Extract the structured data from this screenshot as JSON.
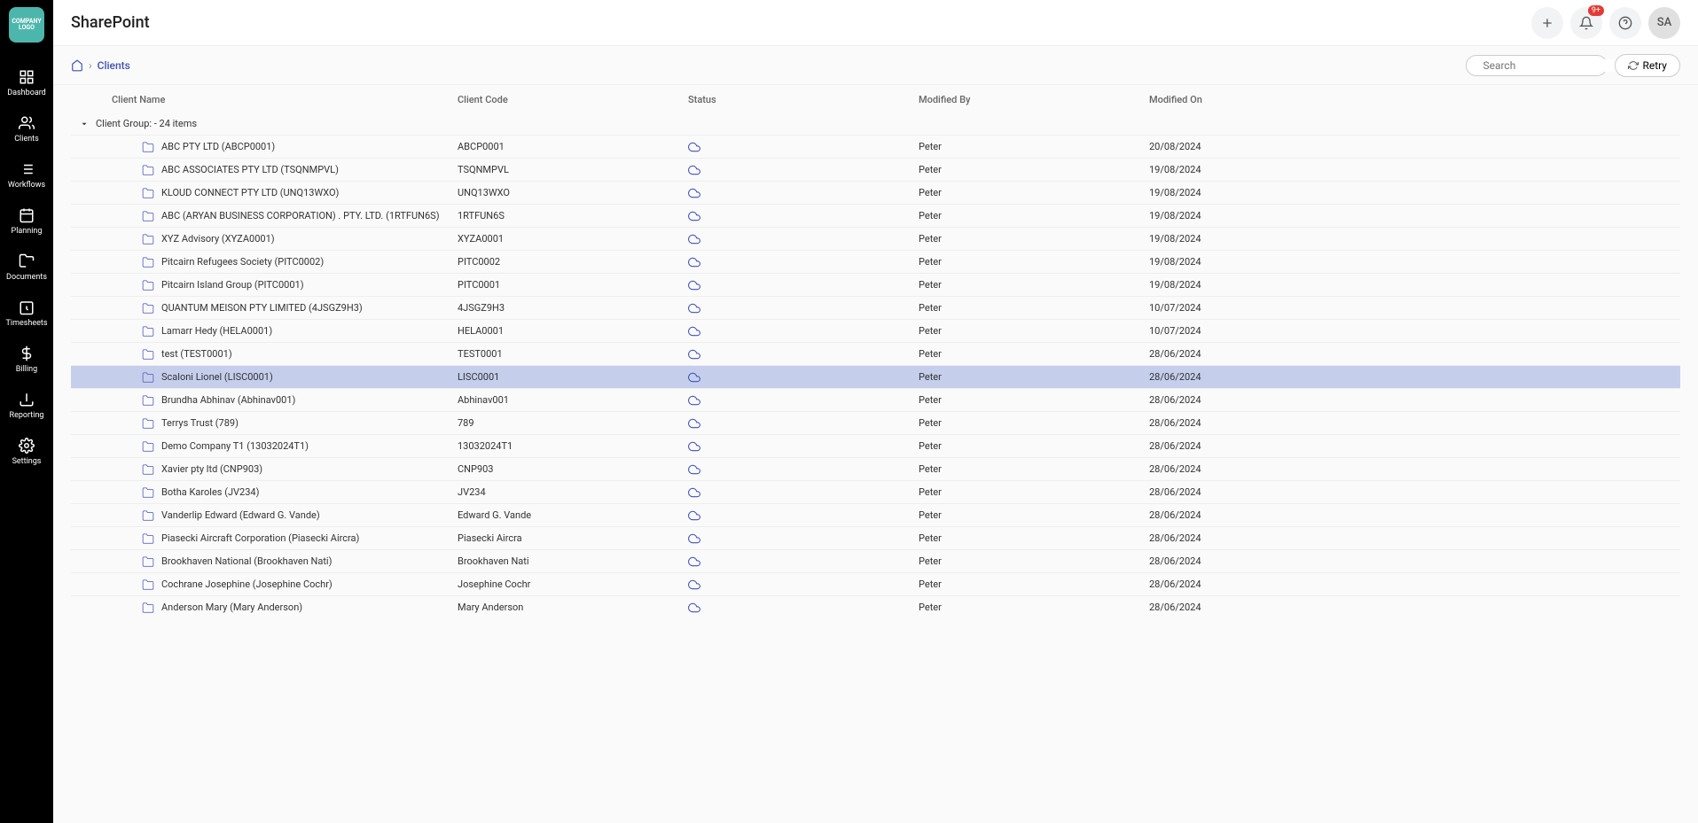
{
  "header": {
    "title": "SharePoint",
    "badge": "9+",
    "avatar": "SA"
  },
  "sidebar": {
    "items": [
      {
        "id": "dashboard",
        "label": "Dashboard"
      },
      {
        "id": "clients",
        "label": "Clients"
      },
      {
        "id": "workflows",
        "label": "Workflows"
      },
      {
        "id": "planning",
        "label": "Planning"
      },
      {
        "id": "documents",
        "label": "Documents"
      },
      {
        "id": "timesheets",
        "label": "Timesheets"
      },
      {
        "id": "billing",
        "label": "Billing"
      },
      {
        "id": "reporting",
        "label": "Reporting"
      },
      {
        "id": "settings",
        "label": "Settings"
      }
    ]
  },
  "breadcrumb": {
    "current": "Clients"
  },
  "search": {
    "placeholder": "Search"
  },
  "retry": {
    "label": "Retry"
  },
  "columns": {
    "name": "Client Name",
    "code": "Client Code",
    "status": "Status",
    "modifiedBy": "Modified By",
    "modifiedOn": "Modified On"
  },
  "group": {
    "label": "Client Group: - 24 items"
  },
  "rows": [
    {
      "name": "ABC PTY LTD (ABCP0001)",
      "code": "ABCP0001",
      "modifiedBy": "Peter",
      "modifiedOn": "20/08/2024"
    },
    {
      "name": "ABC ASSOCIATES PTY LTD (TSQNMPVL)",
      "code": "TSQNMPVL",
      "modifiedBy": "Peter",
      "modifiedOn": "19/08/2024"
    },
    {
      "name": "KLOUD CONNECT PTY LTD (UNQ13WXO)",
      "code": "UNQ13WXO",
      "modifiedBy": "Peter",
      "modifiedOn": "19/08/2024"
    },
    {
      "name": "ABC (ARYAN BUSINESS CORPORATION) . PTY. LTD. (1RTFUN6S)",
      "code": "1RTFUN6S",
      "modifiedBy": "Peter",
      "modifiedOn": "19/08/2024"
    },
    {
      "name": "XYZ Advisory (XYZA0001)",
      "code": "XYZA0001",
      "modifiedBy": "Peter",
      "modifiedOn": "19/08/2024"
    },
    {
      "name": "Pitcairn Refugees Society (PITC0002)",
      "code": "PITC0002",
      "modifiedBy": "Peter",
      "modifiedOn": "19/08/2024"
    },
    {
      "name": "Pitcairn Island Group (PITC0001)",
      "code": "PITC0001",
      "modifiedBy": "Peter",
      "modifiedOn": "19/08/2024"
    },
    {
      "name": "QUANTUM MEISON PTY LIMITED (4JSGZ9H3)",
      "code": "4JSGZ9H3",
      "modifiedBy": "Peter",
      "modifiedOn": "10/07/2024"
    },
    {
      "name": "Lamarr Hedy (HELA0001)",
      "code": "HELA0001",
      "modifiedBy": "Peter",
      "modifiedOn": "10/07/2024"
    },
    {
      "name": "test (TEST0001)",
      "code": "TEST0001",
      "modifiedBy": "Peter",
      "modifiedOn": "28/06/2024"
    },
    {
      "name": "Scaloni Lionel (LISC0001)",
      "code": "LISC0001",
      "modifiedBy": "Peter",
      "modifiedOn": "28/06/2024",
      "selected": true
    },
    {
      "name": "Brundha Abhinav (Abhinav001)",
      "code": "Abhinav001",
      "modifiedBy": "Peter",
      "modifiedOn": "28/06/2024"
    },
    {
      "name": "Terrys Trust (789)",
      "code": "789",
      "modifiedBy": "Peter",
      "modifiedOn": "28/06/2024"
    },
    {
      "name": "Demo Company T1 (13032024T1)",
      "code": "13032024T1",
      "modifiedBy": "Peter",
      "modifiedOn": "28/06/2024"
    },
    {
      "name": "Xavier pty ltd (CNP903)",
      "code": "CNP903",
      "modifiedBy": "Peter",
      "modifiedOn": "28/06/2024"
    },
    {
      "name": "Botha Karoles (JV234)",
      "code": "JV234",
      "modifiedBy": "Peter",
      "modifiedOn": "28/06/2024"
    },
    {
      "name": "Vanderlip Edward (Edward G. Vande)",
      "code": "Edward G. Vande",
      "modifiedBy": "Peter",
      "modifiedOn": "28/06/2024"
    },
    {
      "name": "Piasecki Aircraft Corporation (Piasecki Aircra)",
      "code": "Piasecki Aircra",
      "modifiedBy": "Peter",
      "modifiedOn": "28/06/2024"
    },
    {
      "name": "Brookhaven National (Brookhaven Nati)",
      "code": "Brookhaven Nati",
      "modifiedBy": "Peter",
      "modifiedOn": "28/06/2024"
    },
    {
      "name": "Cochrane Josephine (Josephine Cochr)",
      "code": "Josephine Cochr",
      "modifiedBy": "Peter",
      "modifiedOn": "28/06/2024"
    },
    {
      "name": "Anderson Mary (Mary Anderson)",
      "code": "Mary Anderson",
      "modifiedBy": "Peter",
      "modifiedOn": "28/06/2024"
    }
  ]
}
